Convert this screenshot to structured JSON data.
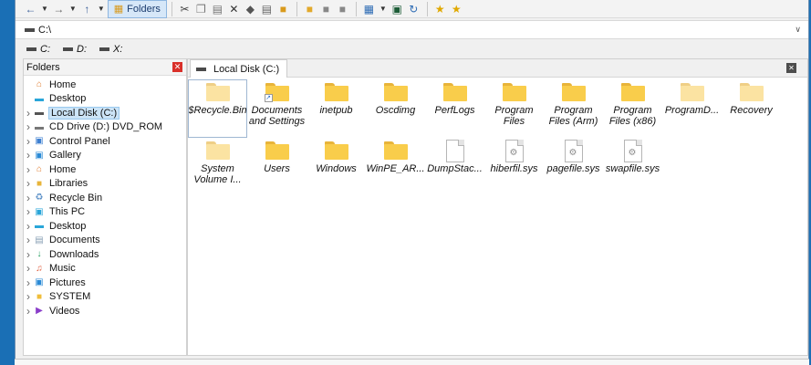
{
  "toolbar": {
    "folders_label": "Folders",
    "buttons": [
      "back-icon",
      "dropdown-icon",
      "forward-icon",
      "dropdown-icon",
      "up-icon",
      "dropdown-icon"
    ],
    "accent": "#3a5f9a"
  },
  "address": {
    "path": "C:\\"
  },
  "drives": [
    {
      "label": "C:"
    },
    {
      "label": "D:"
    },
    {
      "label": "X:"
    }
  ],
  "folders_pane": {
    "title": "Folders",
    "tree": [
      {
        "label": "Home",
        "icon": "home-icon"
      },
      {
        "label": "Desktop",
        "icon": "desktop-icon"
      },
      {
        "label": "Local Disk (C:)",
        "icon": "drive-icon",
        "selected": true
      },
      {
        "label": "CD Drive (D:) DVD_ROM",
        "icon": "cd-drive-icon"
      },
      {
        "label": "Control Panel",
        "icon": "control-panel-icon"
      },
      {
        "label": "Gallery",
        "icon": "gallery-icon"
      },
      {
        "label": "Home",
        "icon": "home-icon"
      },
      {
        "label": "Libraries",
        "icon": "libraries-icon"
      },
      {
        "label": "Recycle Bin",
        "icon": "recycle-bin-icon"
      },
      {
        "label": "This PC",
        "icon": "computer-icon"
      },
      {
        "label": "Desktop",
        "icon": "desktop-icon"
      },
      {
        "label": "Documents",
        "icon": "documents-icon"
      },
      {
        "label": "Downloads",
        "icon": "downloads-icon"
      },
      {
        "label": "Music",
        "icon": "music-icon"
      },
      {
        "label": "Pictures",
        "icon": "pictures-icon"
      },
      {
        "label": "SYSTEM",
        "icon": "folder-icon"
      },
      {
        "label": "Videos",
        "icon": "videos-icon"
      }
    ]
  },
  "tab": {
    "label": "Local Disk (C:)"
  },
  "items": [
    {
      "name": "$Recycle.Bin",
      "kind": "folder-pale"
    },
    {
      "name": "Documents and Settings",
      "kind": "folder-shortcut"
    },
    {
      "name": "inetpub",
      "kind": "folder"
    },
    {
      "name": "Oscdimg",
      "kind": "folder"
    },
    {
      "name": "PerfLogs",
      "kind": "folder"
    },
    {
      "name": "Program Files",
      "kind": "folder"
    },
    {
      "name": "Program Files (Arm)",
      "kind": "folder"
    },
    {
      "name": "Program Files (x86)",
      "kind": "folder"
    },
    {
      "name": "ProgramD...",
      "kind": "folder-pale"
    },
    {
      "name": "Recovery",
      "kind": "folder-pale"
    },
    {
      "name": "System Volume I...",
      "kind": "folder-pale"
    },
    {
      "name": "Users",
      "kind": "folder"
    },
    {
      "name": "Windows",
      "kind": "folder"
    },
    {
      "name": "WinPE_AR...",
      "kind": "folder"
    },
    {
      "name": "DumpStac...",
      "kind": "file"
    },
    {
      "name": "hiberfil.sys",
      "kind": "sysfile"
    },
    {
      "name": "pagefile.sys",
      "kind": "sysfile"
    },
    {
      "name": "swapfile.sys",
      "kind": "sysfile"
    }
  ]
}
